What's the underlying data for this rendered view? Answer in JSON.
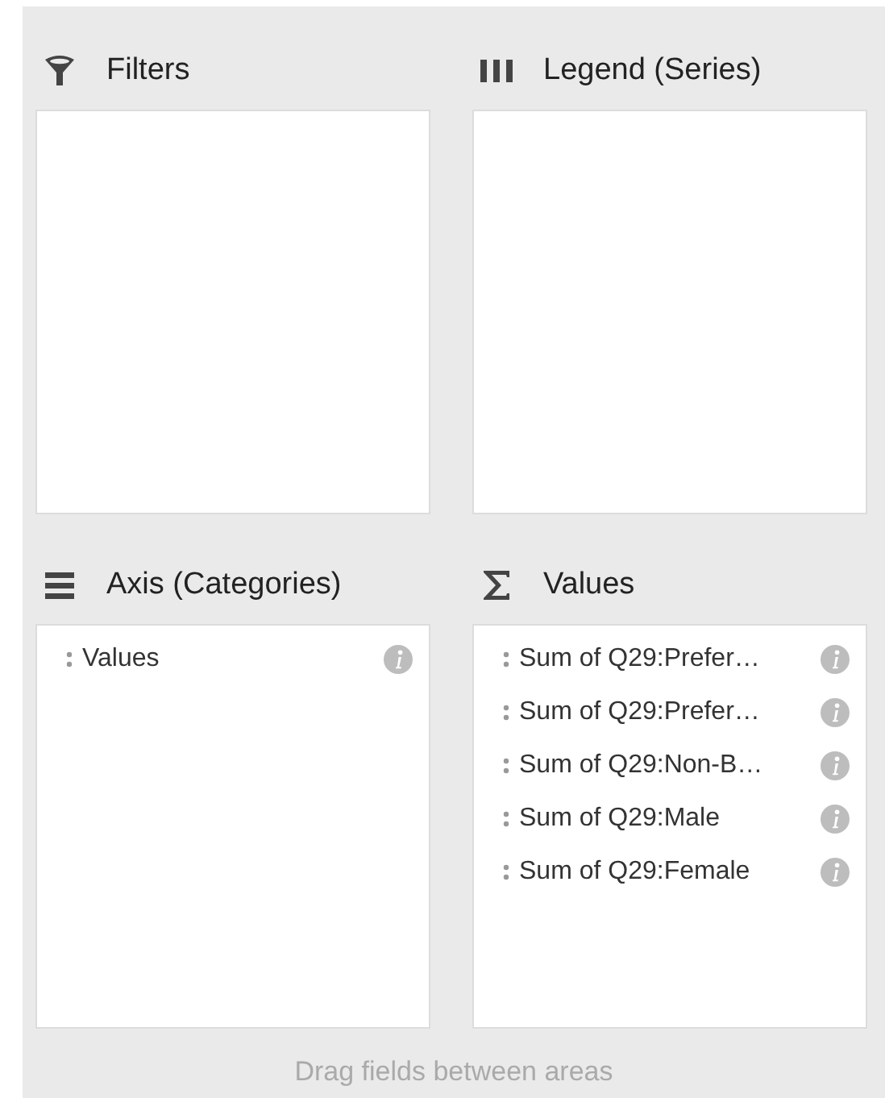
{
  "areas": [
    {
      "kind": "filters",
      "title": "Filters"
    },
    {
      "kind": "legend",
      "title": "Legend (Series)"
    },
    {
      "kind": "axis",
      "title": "Axis (Categories)",
      "fields": [
        {
          "label": "Values"
        }
      ]
    },
    {
      "kind": "values",
      "title": "Values",
      "fields": [
        {
          "label": "Sum of Q29:Prefer…"
        },
        {
          "label": "Sum of Q29:Prefer…"
        },
        {
          "label": "Sum of Q29:Non-B…"
        },
        {
          "label": "Sum of Q29:Male"
        },
        {
          "label": "Sum of Q29:Female"
        }
      ]
    }
  ],
  "footer": "Drag fields between areas"
}
